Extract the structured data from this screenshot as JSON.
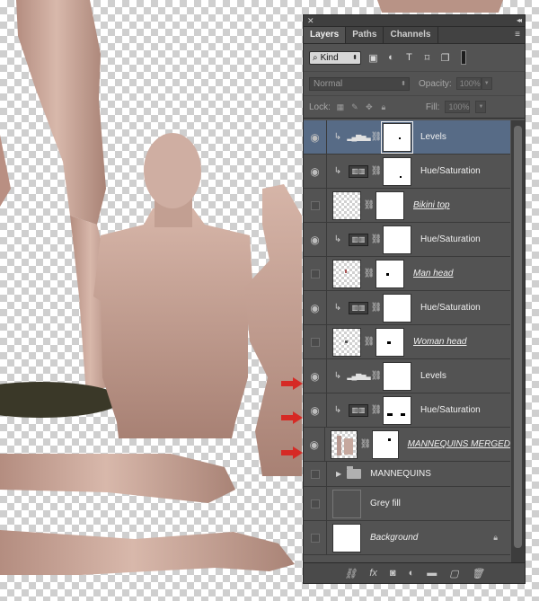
{
  "panel": {
    "close_glyph": "✕",
    "collapse_glyph": "◂◂",
    "tabs": [
      "Layers",
      "Paths",
      "Channels"
    ],
    "panel_menu_glyph": "≡",
    "filter_kind": "Kind",
    "blend_mode": "Normal",
    "opacity_label": "Opacity:",
    "opacity_value": "100%",
    "lock_label": "Lock:",
    "fill_label": "Fill:",
    "fill_value": "100%"
  },
  "layers": [
    {
      "name": "Levels",
      "visible": true,
      "selected": true,
      "clipped": true,
      "kind": "levels"
    },
    {
      "name": "Hue/Saturation",
      "visible": true,
      "clipped": true,
      "kind": "huesat"
    },
    {
      "name": "Bikini top",
      "visible": false,
      "kind": "pixel"
    },
    {
      "name": "Hue/Saturation",
      "visible": true,
      "clipped": true,
      "kind": "huesat"
    },
    {
      "name": "Man head",
      "visible": false,
      "kind": "pixel"
    },
    {
      "name": "Hue/Saturation",
      "visible": true,
      "clipped": true,
      "kind": "huesat"
    },
    {
      "name": "Woman head",
      "visible": false,
      "kind": "pixel"
    },
    {
      "name": "Levels",
      "visible": true,
      "clipped": true,
      "kind": "levels",
      "annotated": true
    },
    {
      "name": "Hue/Saturation",
      "visible": true,
      "clipped": true,
      "kind": "huesat",
      "annotated": true
    },
    {
      "name": "MANNEQUINS MERGED",
      "visible": true,
      "kind": "pixel",
      "annotated": true
    },
    {
      "name": "MANNEQUINS",
      "visible": false,
      "kind": "group"
    },
    {
      "name": "Grey fill",
      "visible": false,
      "kind": "fill"
    },
    {
      "name": "Background",
      "visible": false,
      "kind": "background",
      "locked": true
    }
  ],
  "bottom_icons": [
    "link-icon",
    "fx-icon",
    "mask-icon",
    "adjustment-icon",
    "group-icon",
    "new-layer-icon",
    "trash-icon"
  ],
  "fx_label": "fx",
  "colors": {
    "panel_bg": "#535353",
    "selected_row": "#576b86",
    "annotation_arrow": "#d62a25",
    "mannequin_skin": "#c9a699"
  }
}
